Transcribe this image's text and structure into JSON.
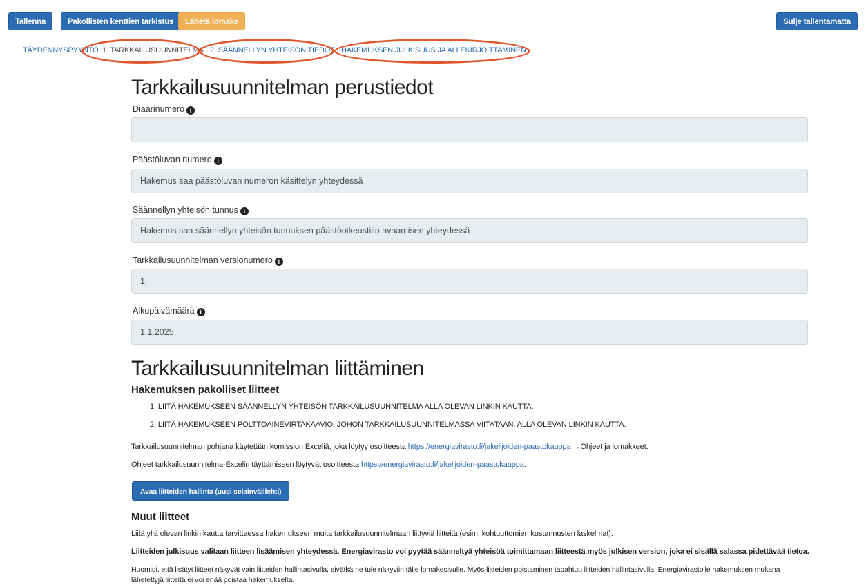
{
  "toolbar": {
    "save": "Tallenna",
    "check_required": "Pakollisten kenttien tarkistus",
    "send": "Lähetä lomake",
    "close_without_save": "Sulje tallentamatta"
  },
  "tabs": [
    {
      "label": "TÄYDENNYSPYYNTÖ"
    },
    {
      "label": "1. TARKKAILUSUUNNITELMA"
    },
    {
      "label": "2. SÄÄNNELLYN YHTEISÖN TIEDOT"
    },
    {
      "label": "HAKEMUKSEN JULKISUUS JA ALLEKIRJOITTAMINEN"
    }
  ],
  "annotation_color": "#e0552a",
  "section1": {
    "title": "Tarkkailusuunnitelman perustiedot",
    "fields": [
      {
        "label": "Diaarinumero",
        "value": ""
      },
      {
        "label": "Päästöluvan numero",
        "value": "Hakemus saa päästöluvan numeron käsittelyn yhteydessä"
      },
      {
        "label": "Säännellyn yhteisön tunnus",
        "value": "Hakemus saa säännellyn yhteisön tunnuksen päästöoikeustilin avaamisen yhteydessä"
      },
      {
        "label": "Tarkkailusuunnitelman versionumero",
        "value": "1"
      },
      {
        "label": "Alkupäivämäärä",
        "value": "1.1.2025"
      }
    ]
  },
  "section2": {
    "title": "Tarkkailusuunnitelman liittäminen",
    "required_heading": "Hakemuksen pakolliset liitteet",
    "list": [
      "1.  LIITÄ HAKEMUKSEEN SÄÄNNELLYN YHTEISÖN TARKKAILUSUUNNITELMA ALLA OLEVAN LINKIN KAUTTA.",
      "2.  LIITÄ HAKEMUKSEEN POLTTOAINEVIRTAKAAVIO, JOHON TARKKAILUSUUNNITELMASSA VIITATAAN, ALLA OLEVAN LINKIN KAUTTA."
    ],
    "template_text": "Tarkkailusuunnitelman pohjana käytetään komission Exceliä, joka löytyy osoitteesta",
    "template_link": "https://energiavirasto.fi/jakelijoiden-paastokauppa",
    "template_suffix": " →Ohjeet ja lomakkeet.",
    "instructions_text": "Ohjeet tarkkailusuunnitelma-Excelin täyttämiseen löytyvät osoitteesta",
    "instructions_link": "https://energiavirasto.fi/jakelijoiden-paastokauppa",
    "instructions_suffix": ".",
    "open_attachments_button": "Avaa liitteiden hallinta (uusi selainvälilehti)",
    "other_heading": "Muut liitteet",
    "other_text": "Liitä yllä olevan linkin kautta tarvittaessa hakemukseen muita tarkkailusuunnitelmaan liittyviä liitteitä (esim. kohtuuttomien kustannusten laskelmat).",
    "publicity_text": "Liitteiden julkisuus valitaan liitteen lisäämisen yhteydessä. Energiavirasto voi pyytää säänneltyä yhteisöä toimittamaan liitteestä myös julkisen version, joka ei sisällä salassa pidettävää tietoa.",
    "note_line1": "Huomioi, että lisätyt liitteet näkyvät vain liitteiden hallintasivulla, eivätkä ne tule näkyviin tälle lomakesivulle. Myös liitteiden poistaminen tapahtuu liitteiden hallintasivulla. Energiavirastolle hakemuksen mukana",
    "note_line2": "lähetettyjä liitteitä ei voi enää poistaa hakemukselta."
  }
}
